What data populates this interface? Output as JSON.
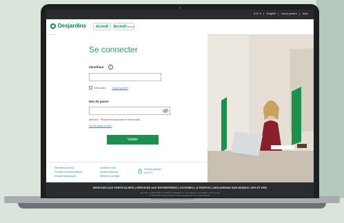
{
  "top_links": [
    "A.D. ▾",
    "English",
    "Nous joindre",
    "Aide"
  ],
  "header": {
    "brand": "Desjardins",
    "accesd": "AccèsD",
    "accesd_affaires": "AccèsD",
    "accesd_affaires_sub": "Affaires"
  },
  "login": {
    "title": "Se connecter",
    "identifiant_label": "Identifiant",
    "remember_label": "Mémoriser",
    "remember_link": "À quoi ça sert?",
    "password_label": "Mot de passe",
    "attention_text": "Attention : Respectez majuscules et minuscules",
    "forgot_link": "Mot de passe oublié?",
    "submit_label": "Valider"
  },
  "footer_links": {
    "col1": [
      "Première à AccèsD",
      "Première à AccèsD Affaires",
      "Sécurité informatique"
    ],
    "col2": [
      "Sécurité du site",
      "Soutien technique",
      "Éléments non fiable"
    ],
    "security_text": [
      "Sécurité garantie",
      "à 100 %"
    ]
  },
  "footer": {
    "nav": "SERVICES AUX PARTICULIERS | SERVICES AUX ENTREPRISES | COOPMEO | À PROPOS | DESJARDINS SUR MOBILE, GPS ET RSS",
    "legal_1": "Sécurité | Confidentialité | Conditions d'utilisation et notes légales | Accessibilité | Plan du site",
    "legal_2": "© 1996-2016, Mouvement des caisses Desjardins. Tous droits réservés."
  },
  "colors": {
    "brand_green": "#00874e",
    "button_green": "#1d8f4f",
    "title_green": "#2e9b6b",
    "footer_dark": "#2b2c2f"
  }
}
